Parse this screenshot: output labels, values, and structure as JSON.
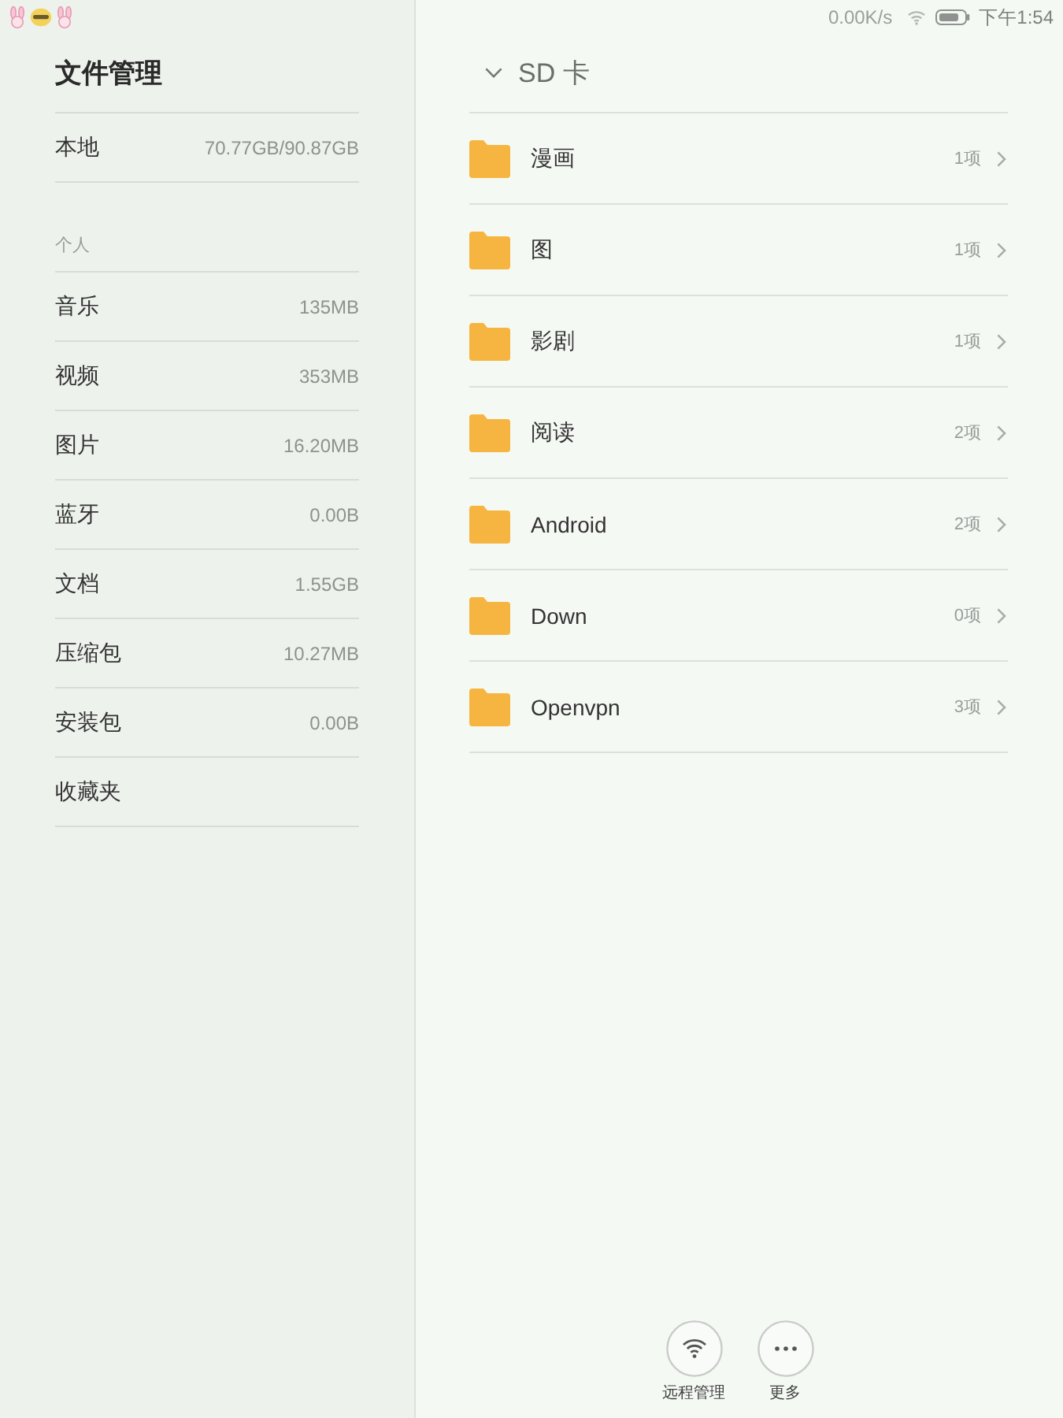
{
  "status_bar": {
    "network_speed": "0.00K/s",
    "time": "下午1:54"
  },
  "sidebar": {
    "title": "文件管理",
    "storage": {
      "label": "本地",
      "value": "70.77GB/90.87GB"
    },
    "section_label": "个人",
    "categories": [
      {
        "label": "音乐",
        "size": "135MB"
      },
      {
        "label": "视频",
        "size": "353MB"
      },
      {
        "label": "图片",
        "size": "16.20MB"
      },
      {
        "label": "蓝牙",
        "size": "0.00B"
      },
      {
        "label": "文档",
        "size": "1.55GB"
      },
      {
        "label": "压缩包",
        "size": "10.27MB"
      },
      {
        "label": "安装包",
        "size": "0.00B"
      },
      {
        "label": "收藏夹"
      }
    ]
  },
  "storage_panel": {
    "header": {
      "title": "SD 卡",
      "expanded": true
    },
    "folders": [
      {
        "name": "漫画",
        "count": "1项"
      },
      {
        "name": "图",
        "count": "1项"
      },
      {
        "name": "影剧",
        "count": "1项"
      },
      {
        "name": "阅读",
        "count": "2项"
      },
      {
        "name": "Android",
        "count": "2项"
      },
      {
        "name": "Down",
        "count": "0项"
      },
      {
        "name": "Openvpn",
        "count": "3项"
      }
    ]
  },
  "bottom_actions": [
    {
      "kind": "remote",
      "label": "远程管理"
    },
    {
      "kind": "more",
      "label": "更多"
    }
  ]
}
